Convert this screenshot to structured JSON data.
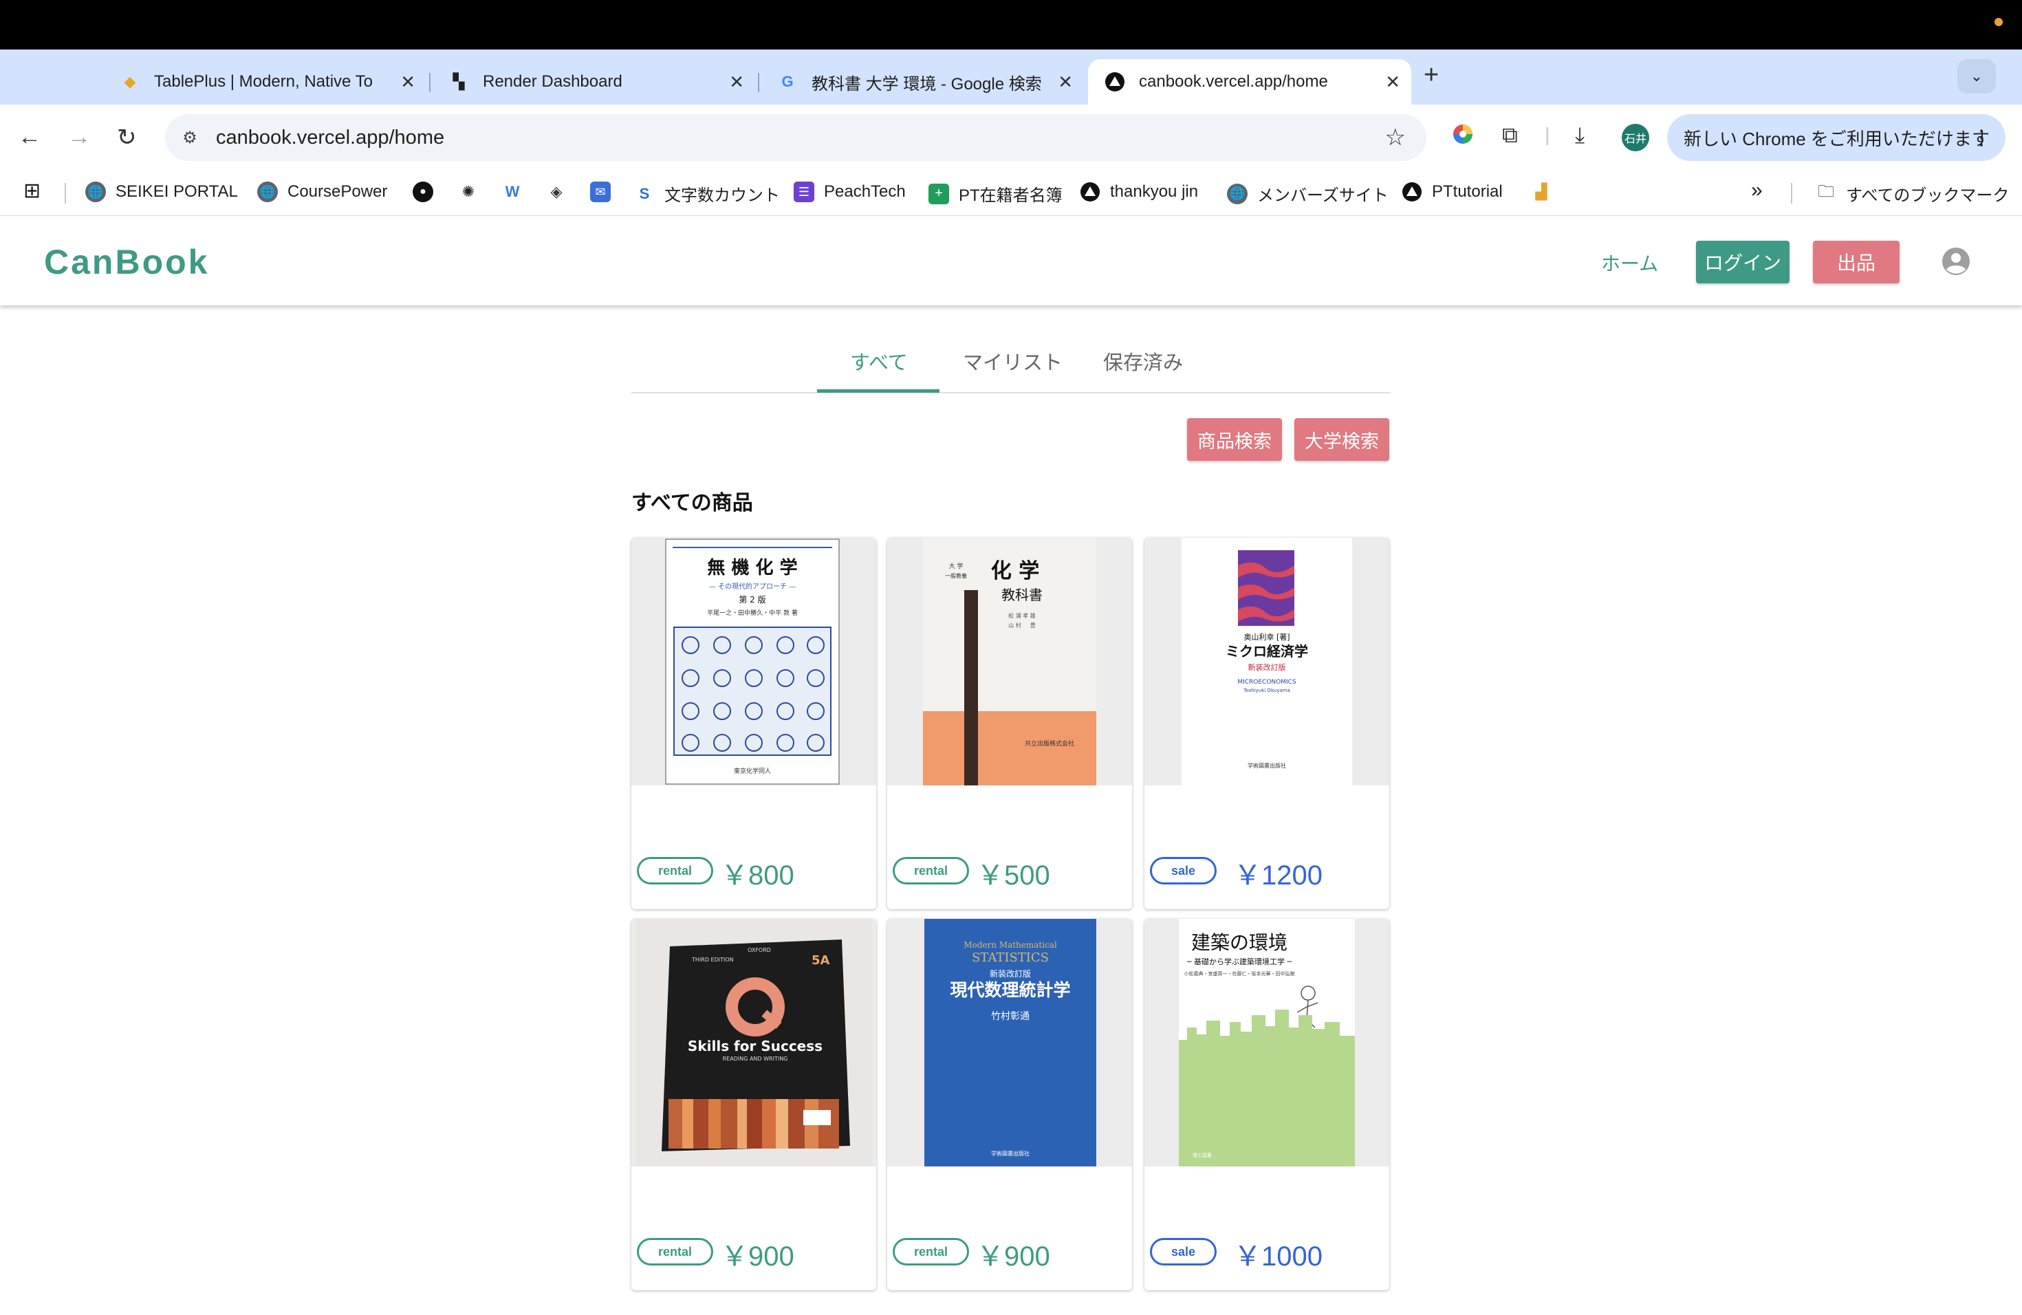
{
  "browser": {
    "tabs": [
      {
        "title": "TablePlus | Modern, Native To",
        "icon": "tableplus-icon"
      },
      {
        "title": "Render Dashboard",
        "icon": "render-icon"
      },
      {
        "title": "教科書 大学 環境 - Google 検索",
        "icon": "google-icon"
      },
      {
        "title": "canbook.vercel.app/home",
        "icon": "vercel-icon",
        "active": true
      }
    ],
    "url": "canbook.vercel.app/home",
    "profile_initials": "石井",
    "chrome_banner": "新しい Chrome をご利用いただけます",
    "bookmarks": [
      {
        "label": "SEIKEI PORTAL",
        "icon": "globe-icon"
      },
      {
        "label": "CoursePower",
        "icon": "globe-icon"
      },
      {
        "label": "",
        "icon": "github-icon"
      },
      {
        "label": "",
        "icon": "openai-icon"
      },
      {
        "label": "",
        "icon": "w-icon"
      },
      {
        "label": "",
        "icon": "diamond-icon"
      },
      {
        "label": "",
        "icon": "mail-icon"
      },
      {
        "label": "文字数カウント",
        "icon": "s-icon"
      },
      {
        "label": "PeachTech",
        "icon": "list-icon"
      },
      {
        "label": "PT在籍者名簿",
        "icon": "plus-sheet-icon"
      },
      {
        "label": "thankyou jin",
        "icon": "vercel-icon"
      },
      {
        "label": "メンバーズサイト",
        "icon": "globe-icon"
      },
      {
        "label": "PTtutorial",
        "icon": "vercel-icon"
      }
    ],
    "all_bookmarks": "すべてのブックマーク"
  },
  "app": {
    "logo": "CanBook",
    "nav_home": "ホーム",
    "login": "ログイン",
    "sell": "出品",
    "tabs": [
      "すべて",
      "マイリスト",
      "保存済み"
    ],
    "search_item": "商品検索",
    "search_univ": "大学検索",
    "section_title": "すべての商品",
    "products": [
      {
        "type": "rental",
        "price": "￥800",
        "book": "無機化学",
        "cover_color": "#ffffff"
      },
      {
        "type": "rental",
        "price": "￥500",
        "book": "化学 教科書",
        "cover_color": "#f19a6b"
      },
      {
        "type": "sale",
        "price": "￥1200",
        "book": "ミクロ経済学",
        "cover_color": "#ffffff"
      },
      {
        "type": "rental",
        "price": "￥900",
        "book": "Skills for Success",
        "cover_color": "#2a2a2a"
      },
      {
        "type": "rental",
        "price": "￥900",
        "book": "現代数理統計学",
        "cover_color": "#2c62b4"
      },
      {
        "type": "sale",
        "price": "￥1000",
        "book": "建築の環境",
        "cover_color": "#b5d88e"
      }
    ]
  },
  "colors": {
    "brand": "#3f9a85",
    "accent": "#e07981",
    "sale": "#3465d6"
  }
}
